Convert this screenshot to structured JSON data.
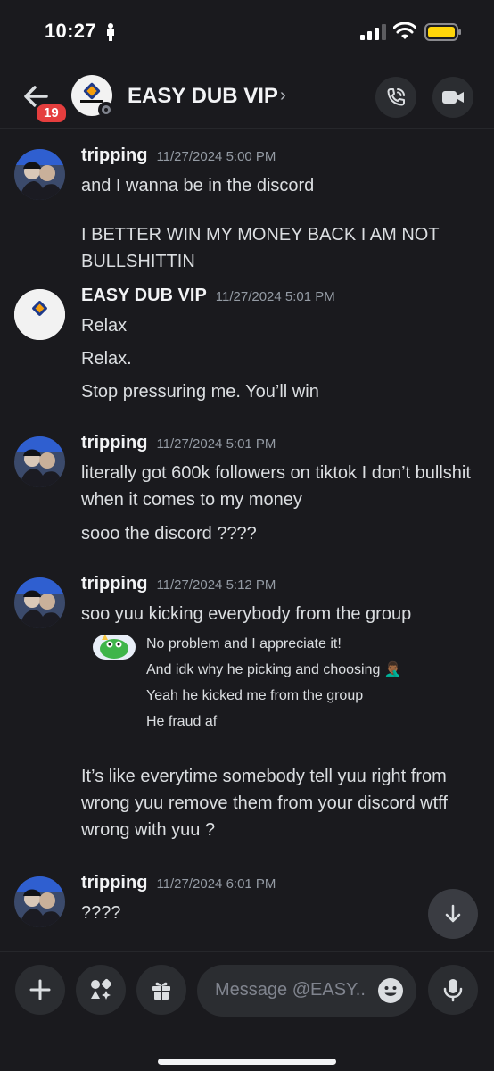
{
  "status_bar": {
    "time": "10:27"
  },
  "header": {
    "badge_count": "19",
    "title": "EASY DUB VIP",
    "chevron": "›",
    "avatar_logo_text": "EasyDubSports"
  },
  "messages": [
    {
      "author": "tripping",
      "timestamp": "11/27/2024 5:00 PM",
      "lines": [
        "and I wanna be in the discord",
        "I BETTER WIN MY MONEY BACK I AM NOT BULLSHITTIN"
      ]
    },
    {
      "author": "EASY DUB VIP",
      "timestamp": "11/27/2024 5:01 PM",
      "avatar_logo_text": "EasyDubSports",
      "lines": [
        "Relax",
        "Relax.",
        "Stop pressuring me. You’ll win"
      ]
    },
    {
      "author": "tripping",
      "timestamp": "11/27/2024 5:01 PM",
      "lines": [
        "literally got 600k followers on tiktok I don’t bullshit when it comes to my money",
        "sooo the discord ????"
      ]
    },
    {
      "author": "tripping",
      "timestamp": "11/27/2024 5:12 PM",
      "lines": [
        "soo yuu kicking everybody from the group"
      ],
      "quoted": [
        "No problem and I appreciate it!",
        "And idk why he picking and choosing 🤦🏾‍♂️",
        "Yeah he kicked me from the group",
        "He fraud af"
      ],
      "after_lines": [
        "It’s like everytime somebody tell yuu right from wrong yuu remove them from your discord wtff wrong with yuu ?"
      ]
    },
    {
      "author": "tripping",
      "timestamp": "11/27/2024 6:01 PM",
      "lines": [
        "????"
      ]
    }
  ],
  "composer": {
    "placeholder": "Message @EASY..",
    "icons": [
      "plus-icon",
      "apps-icon",
      "gift-icon",
      "emoji-icon",
      "microphone-icon"
    ]
  },
  "colors": {
    "background": "#1a1a1e",
    "badge": "#e53e3e",
    "battery": "#ffd60a"
  }
}
